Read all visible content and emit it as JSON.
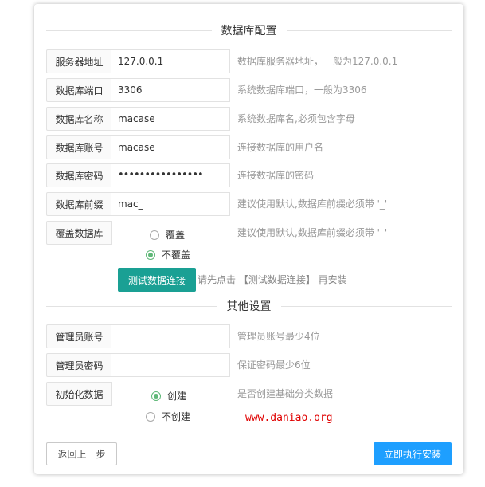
{
  "db_section": {
    "title": "数据库配置",
    "fields": [
      {
        "label": "服务器地址",
        "value": "127.0.0.1",
        "hint": "数据库服务器地址，一般为127.0.0.1"
      },
      {
        "label": "数据库端口",
        "value": "3306",
        "hint": "系统数据库端口，一般为3306"
      },
      {
        "label": "数据库名称",
        "value": "macase",
        "hint": "系统数据库名,必须包含字母"
      },
      {
        "label": "数据库账号",
        "value": "macase",
        "hint": "连接数据库的用户名"
      },
      {
        "label": "数据库密码",
        "value": "••••••••••••••••",
        "hint": "连接数据库的密码"
      },
      {
        "label": "数据库前缀",
        "value": "mac_",
        "hint": "建议使用默认,数据库前缀必须带 '_'"
      }
    ],
    "overwrite": {
      "label": "覆盖数据库",
      "options": [
        "覆盖",
        "不覆盖"
      ],
      "selected": "不覆盖",
      "hint": "建议使用默认,数据库前缀必须带 '_'"
    },
    "test_button": "测试数据连接",
    "test_hint": "请先点击 【测试数据连接】 再安装"
  },
  "other_section": {
    "title": "其他设置",
    "fields": [
      {
        "label": "管理员账号",
        "value": "",
        "hint": "管理员账号最少4位"
      },
      {
        "label": "管理员密码",
        "value": "",
        "hint": "保证密码最少6位"
      }
    ],
    "init_data": {
      "label": "初始化数据",
      "options": [
        "创建",
        "不创建"
      ],
      "selected": "创建",
      "hint": "是否创建基础分类数据"
    }
  },
  "watermark": "www.daniao.org",
  "footer": {
    "back_button": "返回上一步",
    "install_button": "立即执行安装"
  },
  "colors": {
    "accent_green": "#1aa094",
    "radio_green": "#5fb878",
    "primary_blue": "#1e9fff",
    "watermark_red": "#e00000"
  }
}
